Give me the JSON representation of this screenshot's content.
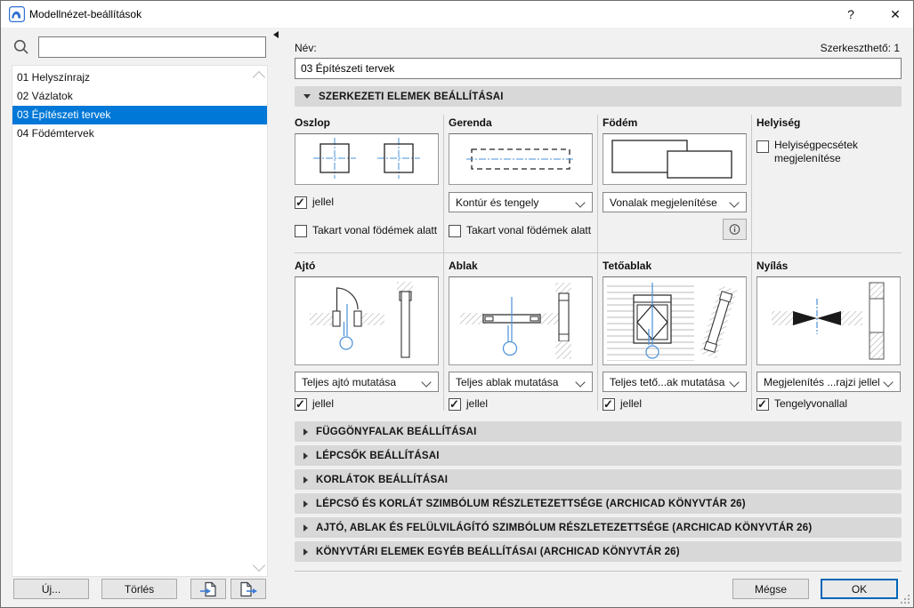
{
  "window": {
    "title": "Modellnézet-beállítások",
    "help_glyph": "?",
    "close_glyph": "✕"
  },
  "sidebar": {
    "search_value": "",
    "items": [
      {
        "label": "01 Helyszínrajz",
        "selected": false
      },
      {
        "label": "02 Vázlatok",
        "selected": false
      },
      {
        "label": "03 Építészeti tervek",
        "selected": true
      },
      {
        "label": "04 Födémtervek",
        "selected": false
      }
    ],
    "new_button": "Új...",
    "delete_button": "Törlés"
  },
  "header": {
    "name_label": "Név:",
    "editable_info": "Szerkeszthető: 1",
    "name_value": "03 Építészeti tervek"
  },
  "structural_section_title": "SZERKEZETI ELEMEK BEÁLLÍTÁSAI",
  "panels": {
    "oszlop": {
      "title": "Oszlop",
      "jellel_label": "jellel",
      "jellel_checked": true,
      "hidden_label": "Takart vonal födémek alatt",
      "hidden_checked": false
    },
    "gerenda": {
      "title": "Gerenda",
      "dropdown_value": "Kontúr és tengely",
      "hidden_label": "Takart vonal födémek alatt",
      "hidden_checked": false
    },
    "fodem": {
      "title": "Födém",
      "dropdown_value": "Vonalak megjelenítése"
    },
    "helyiseg": {
      "title": "Helyiség",
      "stamp_label": "Helyiségpecsétek megjelenítése",
      "stamp_checked": false
    },
    "ajto": {
      "title": "Ajtó",
      "dropdown_value": "Teljes ajtó mutatása",
      "jellel_label": "jellel",
      "jellel_checked": true
    },
    "ablak": {
      "title": "Ablak",
      "dropdown_value": "Teljes ablak mutatása",
      "jellel_label": "jellel",
      "jellel_checked": true
    },
    "tetoablak": {
      "title": "Tetőablak",
      "dropdown_value": "Teljes tető...ak mutatása",
      "jellel_label": "jellel",
      "jellel_checked": true
    },
    "nyilas": {
      "title": "Nyílás",
      "dropdown_value": "Megjelenítés ...rajzi jellel",
      "axis_label": "Tengelyvonallal",
      "axis_checked": true
    }
  },
  "collapsed_sections": [
    "FÜGGÖNYFALAK BEÁLLÍTÁSAI",
    "LÉPCSŐK BEÁLLÍTÁSAI",
    "KORLÁTOK BEÁLLÍTÁSAI",
    "LÉPCSŐ ÉS KORLÁT SZIMBÓLUM RÉSZLETEZETTSÉGE (ARCHICAD KÖNYVTÁR 26)",
    "AJTÓ, ABLAK ÉS FELÜLVILÁGÍTÓ SZIMBÓLUM RÉSZLETEZETTSÉGE (ARCHICAD KÖNYVTÁR 26)",
    "KÖNYVTÁRI ELEMEK EGYÉB BEÁLLÍTÁSAI (ARCHICAD KÖNYVTÁR 26)"
  ],
  "footer": {
    "cancel": "Mégse",
    "ok": "OK"
  },
  "colors": {
    "selection": "#0078d7",
    "symbol_blue": "#4a90d8",
    "ok_border": "#0067b8",
    "section_bg": "#d8d8d8"
  }
}
